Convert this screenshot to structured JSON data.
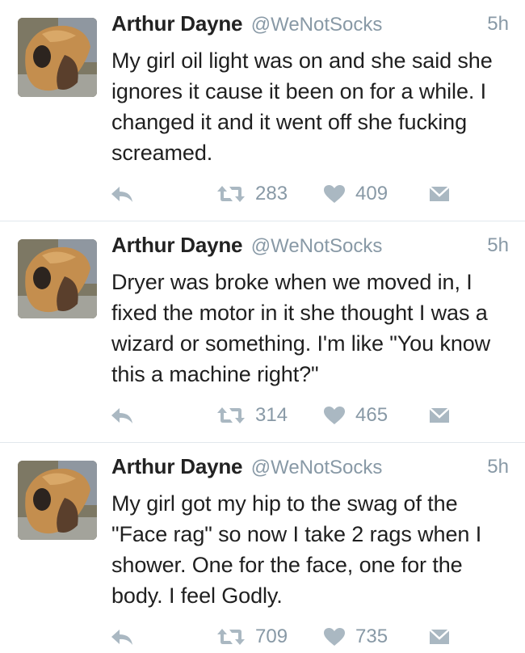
{
  "tweets": [
    {
      "name": "Arthur Dayne",
      "handle": "@WeNotSocks",
      "time": "5h",
      "text": "My girl oil light was on and she said she ignores it cause it been on for a while. I changed it and it went off she fucking screamed.",
      "retweets": "283",
      "likes": "409"
    },
    {
      "name": "Arthur Dayne",
      "handle": "@WeNotSocks",
      "time": "5h",
      "text": "Dryer was broke when we moved in, I fixed the motor in it she thought I was a wizard or something. I'm like \"You know this a machine right?\"",
      "retweets": "314",
      "likes": "465"
    },
    {
      "name": "Arthur Dayne",
      "handle": "@WeNotSocks",
      "time": "5h",
      "text": "My girl got my hip to the swag of the \"Face rag\" so now I take 2 rags when I shower. One for the face, one for the body. I feel Godly.",
      "retweets": "709",
      "likes": "735"
    }
  ],
  "icons": {
    "reply": "reply-icon",
    "retweet": "retweet-icon",
    "like": "heart-icon",
    "dm": "direct-message-icon"
  },
  "colors": {
    "action_gray": "#aab8c2",
    "secondary_text": "#8899a6",
    "divider": "#e1e8ed"
  }
}
